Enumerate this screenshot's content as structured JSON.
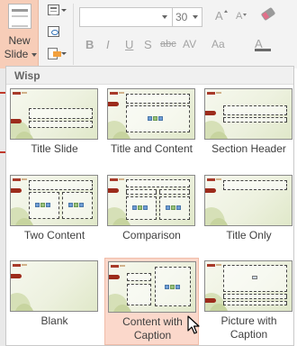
{
  "ribbon": {
    "new_slide_label_line1": "New",
    "new_slide_label_line2": "Slide",
    "font_size": "30",
    "grow_font": "A",
    "shrink_font": "A",
    "bold": "B",
    "italic": "I",
    "underline": "U",
    "shadow": "S",
    "strikethrough": "abc",
    "char_spacing": "AV",
    "change_case": "Aa",
    "font_color": "A"
  },
  "gallery": {
    "header": "Wisp",
    "layouts": [
      {
        "line1": "Title Slide",
        "line2": ""
      },
      {
        "line1": "Title and Content",
        "line2": ""
      },
      {
        "line1": "Section Header",
        "line2": ""
      },
      {
        "line1": "Two Content",
        "line2": ""
      },
      {
        "line1": "Comparison",
        "line2": ""
      },
      {
        "line1": "Title Only",
        "line2": ""
      },
      {
        "line1": "Blank",
        "line2": ""
      },
      {
        "line1": "Content with",
        "line2": "Caption"
      },
      {
        "line1": "Picture with",
        "line2": "Caption"
      }
    ],
    "selected_index": 7
  },
  "colors": {
    "accent": "#9c2b1b",
    "selection": "#fbd8cb",
    "new_slide_highlight": "#f7cdb8"
  },
  "icons": [
    "layout-icon",
    "reset-icon",
    "section-icon",
    "clear-formatting-icon",
    "mouse-pointer-icon"
  ]
}
